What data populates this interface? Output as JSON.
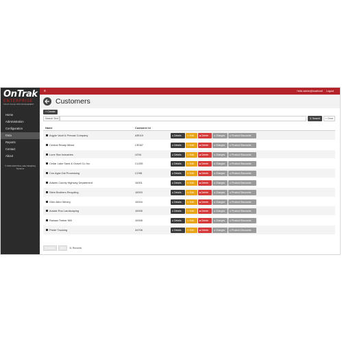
{
  "brand": {
    "name": "OnTrak",
    "edition": "ENTERPRISE",
    "tagline": "TRUCK SCALE DATA MANAGEMENT"
  },
  "sidebar": {
    "items": [
      {
        "label": "Home",
        "active": false
      },
      {
        "label": "Administration",
        "active": false
      },
      {
        "label": "Configuration",
        "active": false
      },
      {
        "label": "Data",
        "active": true
      },
      {
        "label": "Reports",
        "active": false
      },
      {
        "label": "Contact",
        "active": false
      },
      {
        "label": "About",
        "active": false
      }
    ],
    "footer": "© 2020-2023 Rice Lake Weighing Systems"
  },
  "topbar": {
    "menu_icon": "hamburger-icon",
    "greeting": "Hello admin@localhost!",
    "logout": "Logout"
  },
  "page": {
    "title": "Customers",
    "create_label": "+ Create",
    "search_label": "Search Text",
    "search_value": "",
    "search_button": "Search",
    "clear_button": "Clear"
  },
  "table": {
    "columns": [
      "Name",
      "Customer Id"
    ],
    "actions": {
      "details": "Details",
      "edit": "Edit",
      "delete": "Delete",
      "charges": "Charges",
      "discounts": "Product Discounts"
    },
    "rows": [
      {
        "name": "Argyle Vault & Precast Company",
        "id": "AR019"
      },
      {
        "name": "Central Ready Mixed",
        "id": "CE067"
      },
      {
        "name": "Lone Star Industries",
        "id": "LE04"
      },
      {
        "name": "Cedar Lake Sand & Gravel Co Inc.",
        "id": "CL039"
      },
      {
        "name": "Con Agra Oat Processing",
        "id": "CO98"
      },
      {
        "name": "Adams County Highway Department",
        "id": "10001"
      },
      {
        "name": "Stein Brothers Recycling",
        "id": "10003"
      },
      {
        "name": "Glen Allen Winery",
        "id": "10004"
      },
      {
        "name": "Aussie Roo Landscaping",
        "id": "10005"
      },
      {
        "name": "Raisaw Timber Mill",
        "id": "10008"
      },
      {
        "name": "Prede Trucking",
        "id": "34708"
      }
    ]
  },
  "pager": {
    "prev": "Previous",
    "next": "Next",
    "count": "11 Records"
  },
  "colors": {
    "topbar": "#b5232a",
    "sidebar": "#2b2b2b",
    "edit": "#e8a417",
    "delete": "#d43a3a",
    "details": "#3c3c3c",
    "muted": "#9a9a9a"
  }
}
